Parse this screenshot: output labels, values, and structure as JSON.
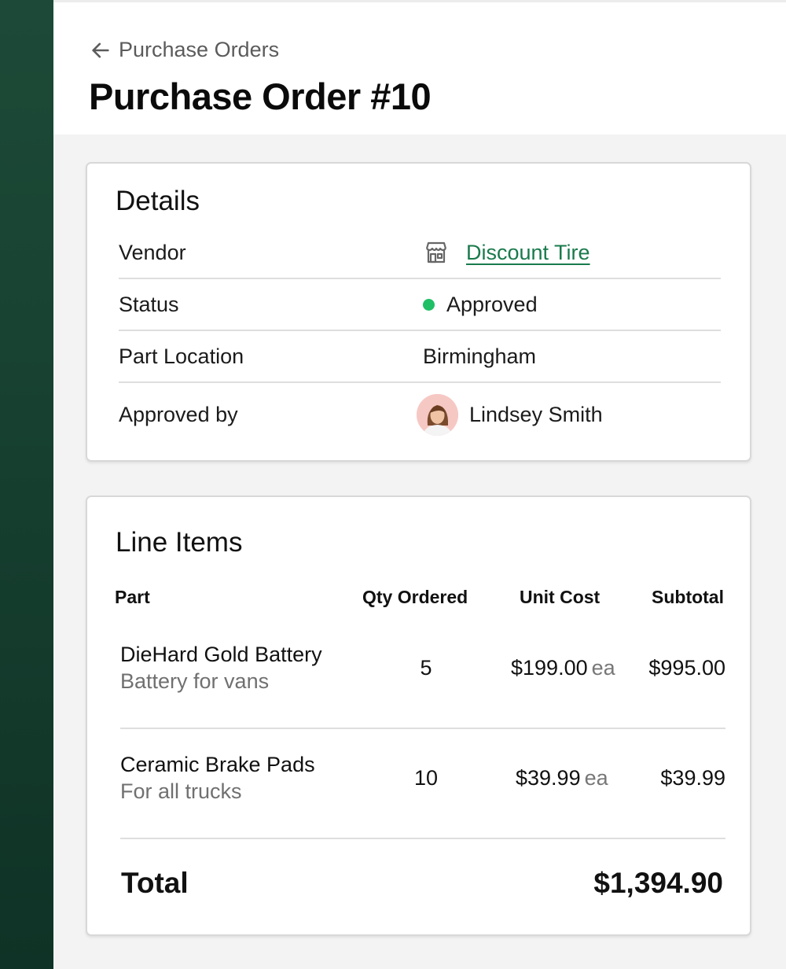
{
  "breadcrumb": {
    "back_label": "Purchase Orders"
  },
  "page": {
    "title": "Purchase Order #10"
  },
  "details": {
    "title": "Details",
    "rows": [
      {
        "label": "Vendor",
        "value": "Discount Tire",
        "icon": "store-icon"
      },
      {
        "label": "Status",
        "value": "Approved",
        "status_color": "#1fbf66"
      },
      {
        "label": "Part Location",
        "value": "Birmingham"
      },
      {
        "label": "Approved by",
        "value": "Lindsey Smith",
        "icon": "avatar"
      }
    ]
  },
  "line_items": {
    "title": "Line Items",
    "columns": [
      "Part",
      "Qty Ordered",
      "Unit Cost",
      "Subtotal"
    ],
    "items": [
      {
        "name": "DieHard Gold Battery",
        "description": "Battery for vans",
        "qty": "5",
        "unit_cost": "$199.00",
        "unit_suffix": "ea",
        "subtotal": "$995.00"
      },
      {
        "name": "Ceramic Brake Pads",
        "description": "For all trucks",
        "qty": "10",
        "unit_cost": "$39.99",
        "unit_suffix": "ea",
        "subtotal": "$39.99"
      }
    ],
    "total_label": "Total",
    "total_value": "$1,394.90"
  },
  "colors": {
    "sidebar": "#1a4533",
    "link": "#1a7a4c",
    "status_approved": "#1fbf66",
    "background": "#f3f3f3"
  }
}
